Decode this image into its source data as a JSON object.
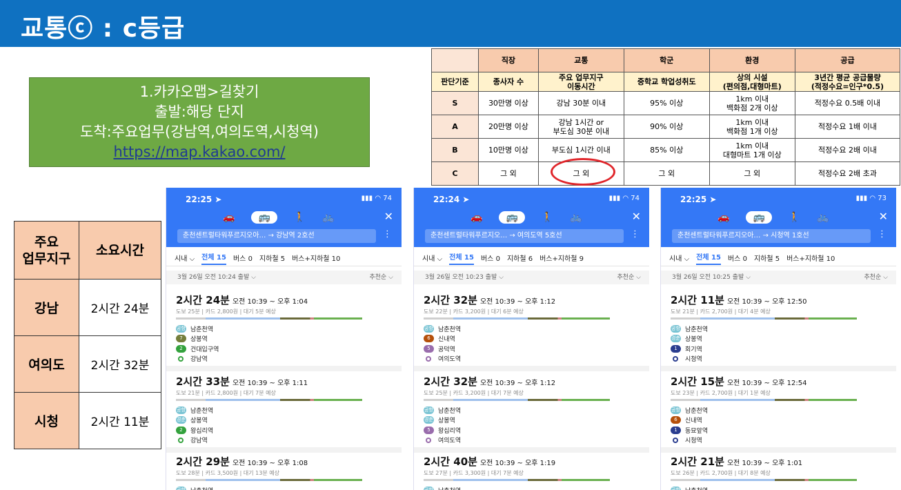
{
  "title": "교통ⓒ : c등급",
  "instruction": {
    "line1": "1.카카오맵>길찾기",
    "line2": "출발:해당 단지",
    "line3": "도착:주요업무(강남역,여의도역,시청역)",
    "url": "https://map.kakao.com/"
  },
  "criteria": {
    "headers": [
      "직장",
      "교통",
      "학군",
      "환경",
      "공급"
    ],
    "corner": "",
    "sub_label": "판단기준",
    "sub": [
      "종사자 수",
      "주요 업무지구\n이동시간",
      "중학교 학업성취도",
      "상의 시설\n(편의점,대형마트)",
      "3년간 평균 공급물량\n(적정수요=인구*0.5)"
    ],
    "rows": [
      {
        "grade": "S",
        "cells": [
          "30만명 이상",
          "강남 30분 이내",
          "95% 이상",
          "1km 이내\n백화점 2개 이상",
          "적정수요 0.5배 이내"
        ]
      },
      {
        "grade": "A",
        "cells": [
          "20만명 이상",
          "강남 1시간 or\n부도심 30분 이내",
          "90% 이상",
          "1km 이내\n백화점 1개 이상",
          "적정수요 1배 이내"
        ]
      },
      {
        "grade": "B",
        "cells": [
          "10만명 이상",
          "부도심 1시간 이내",
          "85% 이상",
          "1km 이내\n대형마트 1개 이상",
          "적정수요 2배 이내"
        ]
      },
      {
        "grade": "C",
        "cells": [
          "그 외",
          "그 외",
          "그 외",
          "그 외",
          "적정수요 2배 초과"
        ]
      }
    ]
  },
  "summary": {
    "header_key": "주요\n업무지구",
    "header_val": "소요시간",
    "rows": [
      {
        "key": "강남",
        "val": "2시간 24분"
      },
      {
        "key": "여의도",
        "val": "2시간 32분"
      },
      {
        "key": "시청",
        "val": "2시간 11분"
      }
    ]
  },
  "phones": [
    {
      "status_time": "22:25 ➤",
      "status_right": "▮▮▮ ◠ 74",
      "route": "춘천센트럴타워푸르지오아… → 강남역 2호선",
      "filters": [
        "시내 ⌵",
        "전체 15",
        "버스 0",
        "지하철 5",
        "버스+지하철 10"
      ],
      "depart": "3월 26일 오전 10:24 출발 ⌵",
      "sort": "추천순 ⌵",
      "cards": [
        {
          "dur": "2시간 24분",
          "time": "오전 10:39 ~ 오후 1:04",
          "info": "도보 25분 | 카드 2,800원 | 대기 5분 예상",
          "stops": [
            {
              "badge": "공항",
              "cls": "c-bus",
              "name": "남춘천역"
            },
            {
              "badge": "7",
              "cls": "c-7",
              "name": "상봉역"
            },
            {
              "badge": "2",
              "cls": "c-2",
              "name": "건대입구역"
            },
            {
              "badge": "",
              "cls": "c-end",
              "name": "강남역"
            }
          ]
        },
        {
          "dur": "2시간 33분",
          "time": "오전 10:39 ~ 오후 1:11",
          "info": "도보 21분 | 카드 2,800원 | 대기 7분 예상",
          "stops": [
            {
              "badge": "공항",
              "cls": "c-bus",
              "name": "남춘천역"
            },
            {
              "badge": "경춘",
              "cls": "c-bus",
              "name": "상봉역"
            },
            {
              "badge": "2",
              "cls": "c-2",
              "name": "왕십리역"
            },
            {
              "badge": "",
              "cls": "c-end",
              "name": "강남역"
            }
          ]
        },
        {
          "dur": "2시간 29분",
          "time": "오전 10:39 ~ 오후 1:08",
          "info": "도보 28분 | 카드 3,500원 | 대기 13분 예상",
          "stops": [
            {
              "badge": "공항",
              "cls": "c-bus",
              "name": "남춘천역"
            }
          ]
        }
      ]
    },
    {
      "status_time": "22:24 ➤",
      "status_right": "▮▮▮ ◠ 74",
      "route": "춘천센트럴타워푸르지오… → 여의도역 5호선",
      "filters": [
        "시내 ⌵",
        "전체 15",
        "버스 0",
        "지하철 6",
        "버스+지하철 9"
      ],
      "depart": "3월 26일 오전 10:23 출발 ⌵",
      "sort": "추천순 ⌵",
      "cards": [
        {
          "dur": "2시간 32분",
          "time": "오전 10:39 ~ 오후 1:12",
          "info": "도보 22분 | 카드 3,200원 | 대기 6분 예상",
          "stops": [
            {
              "badge": "공항",
              "cls": "c-bus",
              "name": "남춘천역"
            },
            {
              "badge": "6",
              "cls": "c-6",
              "name": "신내역"
            },
            {
              "badge": "5",
              "cls": "c-5",
              "name": "공덕역"
            },
            {
              "badge": "",
              "cls": "c-end5",
              "name": "여의도역"
            }
          ]
        },
        {
          "dur": "2시간 32분",
          "time": "오전 10:39 ~ 오후 1:12",
          "info": "도보 25분 | 카드 3,200원 | 대기 7분 예상",
          "stops": [
            {
              "badge": "공항",
              "cls": "c-bus",
              "name": "남춘천역"
            },
            {
              "badge": "경춘",
              "cls": "c-bus",
              "name": "상봉역"
            },
            {
              "badge": "5",
              "cls": "c-5",
              "name": "왕십리역"
            },
            {
              "badge": "",
              "cls": "c-end5",
              "name": "여의도역"
            }
          ]
        },
        {
          "dur": "2시간 40분",
          "time": "오전 10:39 ~ 오후 1:19",
          "info": "도보 27분 | 카드 3,300원 | 대기 7분 예상",
          "stops": [
            {
              "badge": "공항",
              "cls": "c-bus",
              "name": "남춘천역"
            }
          ]
        }
      ]
    },
    {
      "status_time": "22:25 ➤",
      "status_right": "▮▮▮ ◠ 73",
      "route": "춘천센트럴타워푸르지오아… → 시청역 1호선",
      "filters": [
        "시내 ⌵",
        "전체 15",
        "버스 0",
        "지하철 5",
        "버스+지하철 10"
      ],
      "depart": "3월 26일 오전 10:25 출발 ⌵",
      "sort": "추천순 ⌵",
      "cards": [
        {
          "dur": "2시간 11분",
          "time": "오전 10:39 ~ 오후 12:50",
          "info": "도보 21분 | 카드 2,700원 | 대기 4분 예상",
          "stops": [
            {
              "badge": "공항",
              "cls": "c-bus",
              "name": "남춘천역"
            },
            {
              "badge": "경춘",
              "cls": "c-bus",
              "name": "상봉역"
            },
            {
              "badge": "1",
              "cls": "c-1",
              "name": "회기역"
            },
            {
              "badge": "",
              "cls": "c-end1",
              "name": "시청역"
            }
          ]
        },
        {
          "dur": "2시간 15분",
          "time": "오전 10:39 ~ 오후 12:54",
          "info": "도보 23분 | 카드 2,700원 | 대기 1분 예상",
          "stops": [
            {
              "badge": "공항",
              "cls": "c-bus",
              "name": "남춘천역"
            },
            {
              "badge": "6",
              "cls": "c-6",
              "name": "신내역"
            },
            {
              "badge": "1",
              "cls": "c-1",
              "name": "동묘앞역"
            },
            {
              "badge": "",
              "cls": "c-end1",
              "name": "시청역"
            }
          ]
        },
        {
          "dur": "2시간 21분",
          "time": "오전 10:39 ~ 오후 1:01",
          "info": "도보 26분 | 카드 2,700원 | 대기 8분 예상",
          "stops": [
            {
              "badge": "공항",
              "cls": "c-bus",
              "name": "남춘천역"
            }
          ]
        }
      ]
    }
  ]
}
